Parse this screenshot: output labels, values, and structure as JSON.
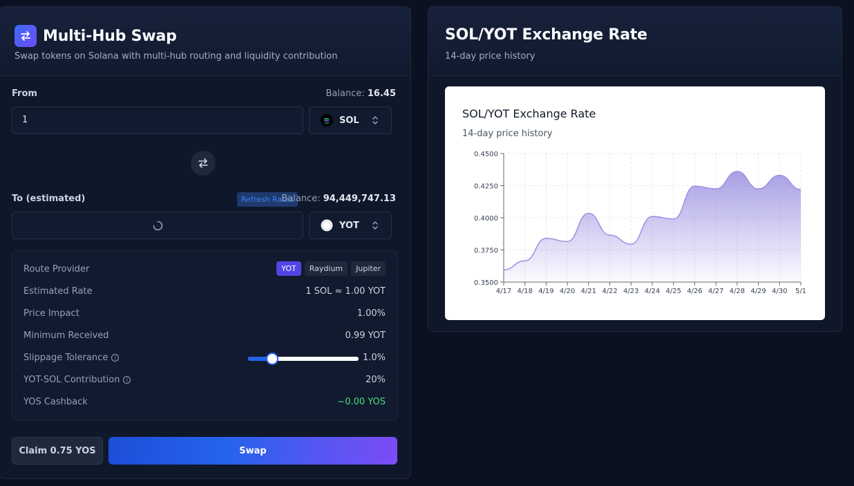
{
  "swap": {
    "title": "Multi-Hub Swap",
    "subtitle": "Swap tokens on Solana with multi-hub routing and liquidity contribution",
    "from": {
      "label": "From",
      "balance_label": "Balance:",
      "balance": "16.45",
      "value": "1",
      "token": "SOL"
    },
    "to": {
      "label": "To (estimated)",
      "refresh_label": "Refresh Rates",
      "balance_label": "Balance:",
      "balance": "94,449,747.13",
      "token": "YOT"
    },
    "details": {
      "route_label": "Route Provider",
      "providers": [
        "YOT",
        "Raydium",
        "Jupiter"
      ],
      "active_provider": "YOT",
      "rate_label": "Estimated Rate",
      "rate": "1 SOL ≈ 1.00 YOT",
      "impact_label": "Price Impact",
      "impact": "1.00%",
      "min_label": "Minimum Received",
      "min": "0.99 YOT",
      "slippage_label": "Slippage Tolerance",
      "slippage": "1.0%",
      "slippage_level": 0.22,
      "contribution_label": "YOT-SOL Contribution",
      "contribution": "20%",
      "cashback_label": "YOS Cashback",
      "cashback": "~0.00 YOS"
    },
    "claim_label": "Claim 0.75 YOS",
    "swap_label": "Swap"
  },
  "rate": {
    "title": "SOL/YOT Exchange Rate",
    "subtitle": "14-day price history"
  },
  "colors": {
    "accent": "#2563eb",
    "purple": "#7c4cf6",
    "cashback": "#4ade80",
    "chart_line": "#9b8fe0"
  },
  "chart_data": {
    "type": "area",
    "title": "SOL/YOT Exchange Rate",
    "subtitle": "14-day price history",
    "x": [
      "4/17",
      "4/18",
      "4/19",
      "4/20",
      "4/21",
      "4/22",
      "4/23",
      "4/24",
      "4/25",
      "4/26",
      "4/27",
      "4/28",
      "4/29",
      "4/30",
      "5/1"
    ],
    "y": [
      0.3595,
      0.3665,
      0.384,
      0.3815,
      0.4035,
      0.3865,
      0.3795,
      0.401,
      0.399,
      0.4245,
      0.4225,
      0.436,
      0.4225,
      0.433,
      0.422
    ],
    "yticks": [
      "0.4500",
      "0.4250",
      "0.4000",
      "0.3750",
      "0.3500"
    ],
    "ylim": [
      0.35,
      0.45
    ],
    "grid": true,
    "xlabel": "",
    "ylabel": ""
  }
}
